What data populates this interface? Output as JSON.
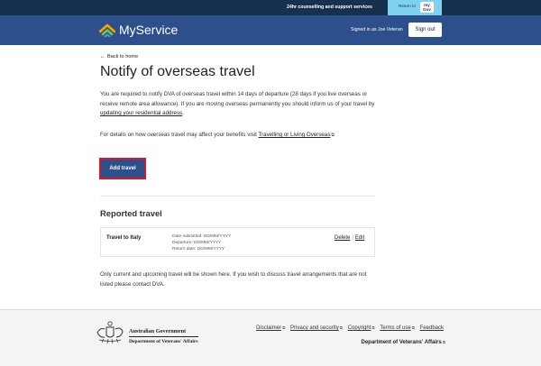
{
  "topbar": {
    "support_link": "24hr counselling and support services",
    "return_label": "Return to",
    "mygov_logo_top": "my",
    "mygov_logo_bottom": "Gov"
  },
  "header": {
    "brand": "MyService",
    "signed_in": "Signed in as Joe Veteran",
    "sign_out": "Sign out",
    "brand_colors": [
      "#f2a900",
      "#7fc241",
      "#3aa6dd"
    ]
  },
  "page": {
    "back_link": "Back to home",
    "title": "Notify of overseas travel",
    "para1_text": "You are required to notify DVA of overseas travel within 14 days of departure (28 days if you live overseas or receive remote area allowance). If you are moving overseas permanently you should inform us of your travel by ",
    "para1_link": "updating your residential address",
    "para1_end": ".",
    "para2_text": "For details on how overseas travel may affect your benefits visit ",
    "para2_link": "Travelling or Living Overseas",
    "add_travel": "Add travel",
    "reported_heading": "Reported travel",
    "trip": {
      "destination": "Travel to Italy",
      "date_submitted": "Date submitted: DD/MM/YYYY",
      "departure": "Departure: DD/MM/YYYY",
      "return": "Return date: DD/MM/YYYY",
      "delete": "Delete",
      "edit": "Edit"
    },
    "para3": "Only current and upcoming travel will be shown here. If you wish to discuss travel arrangements that are not listed please contact DVA."
  },
  "footer": {
    "gov_line1": "Australian Government",
    "gov_line2": "Department of Veterans' Affairs",
    "links": [
      "Disclaimer",
      "Privacy and security",
      "Copyright",
      "Terms of use",
      "Feedback"
    ],
    "dva_link": "Department of Veterans' Affairs"
  },
  "colors": {
    "topbar": "#18304f",
    "header": "#2d4f8b",
    "mygov": "#7fd1f0",
    "button": "#2d4f8b",
    "button_focus": "#d21a28"
  }
}
